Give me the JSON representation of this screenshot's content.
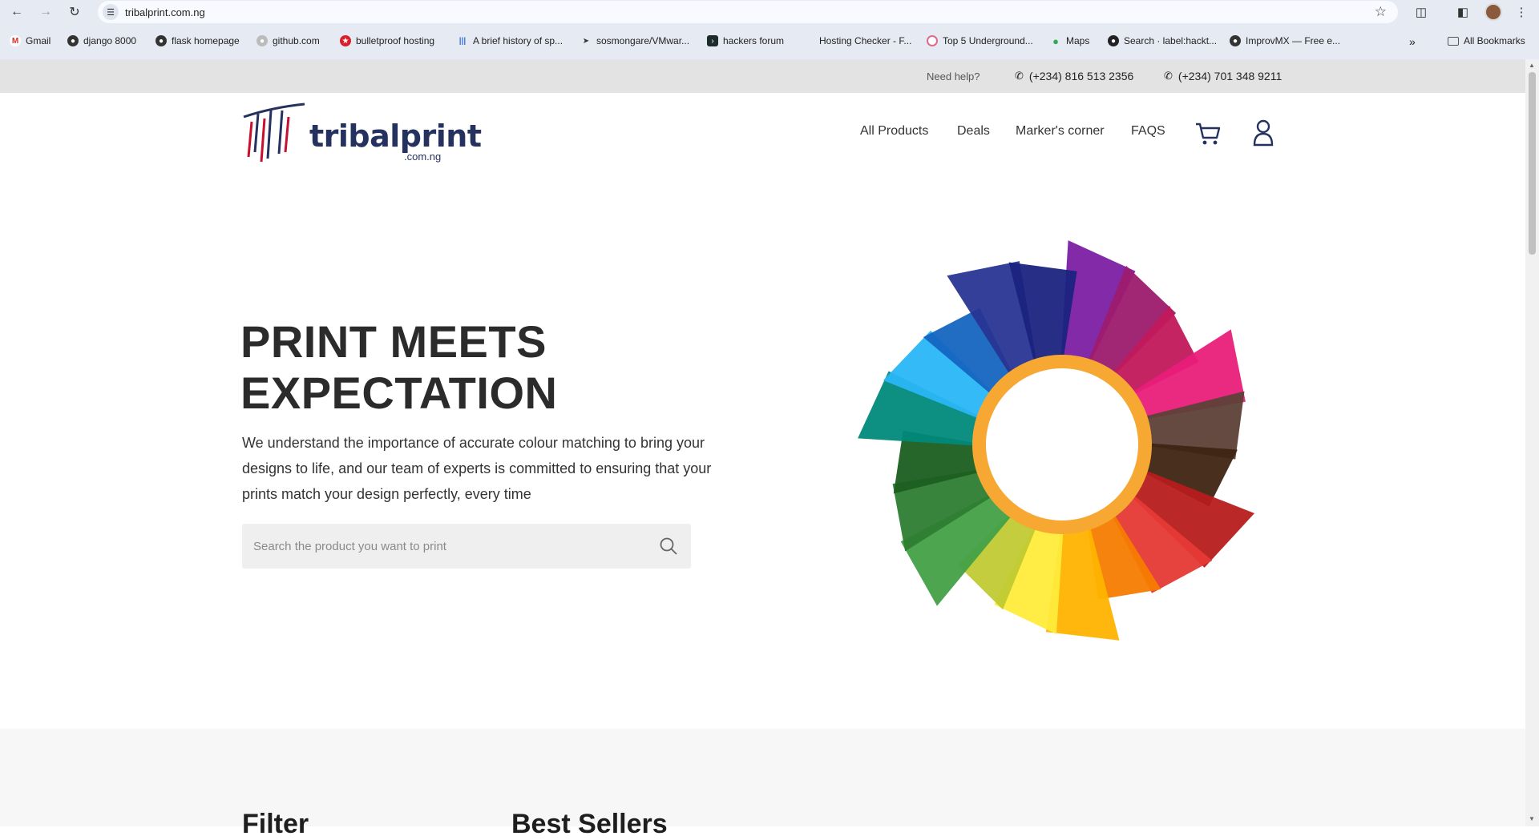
{
  "browser": {
    "url": "tribalprint.com.ng",
    "bookmarks": [
      {
        "label": "Gmail",
        "icon": "gmail-icon"
      },
      {
        "label": "django 8000",
        "icon": "globe-icon"
      },
      {
        "label": "flask homepage",
        "icon": "globe-icon"
      },
      {
        "label": "github.com",
        "icon": "github-icon"
      },
      {
        "label": "bulletproof hosting",
        "icon": "star-badge-icon"
      },
      {
        "label": "A brief history of sp...",
        "icon": "bars-icon"
      },
      {
        "label": "sosmongare/VMwar...",
        "icon": "send-icon"
      },
      {
        "label": "hackers forum",
        "icon": "terminal-icon"
      },
      {
        "label": "Hosting Checker - F...",
        "icon": ""
      },
      {
        "label": "Top 5 Underground...",
        "icon": "ring-icon"
      },
      {
        "label": "Maps",
        "icon": "map-pin-icon"
      },
      {
        "label": "Search · label:hackt...",
        "icon": "github-icon"
      },
      {
        "label": "ImprovMX — Free e...",
        "icon": "globe-icon"
      }
    ],
    "more": "»",
    "all_bookmarks": "All Bookmarks"
  },
  "topbar": {
    "help": "Need help?",
    "phone": "(+234) 816 513 2356",
    "whatsapp": "(+234) 701 348 9211"
  },
  "header": {
    "logo_text": "tribalprint",
    "logo_sub": ".com.ng",
    "menu": [
      "All Products",
      "Deals",
      "Marker's corner",
      "FAQS"
    ]
  },
  "hero": {
    "title_line1": "PRINT MEETS",
    "title_line2": "EXPECTATION",
    "description": "We understand the importance of accurate colour matching to bring your designs to life, and our team of experts is committed to ensuring that your prints match your design perfectly, every time",
    "search_placeholder": "Search the product you want to print"
  },
  "lower": {
    "filter_heading": "Filter",
    "best_sellers_heading": "Best Sellers"
  },
  "colors": {
    "brand_navy": "#25325f",
    "brand_red": "#c8102e",
    "ring_orange": "#f7a833"
  }
}
